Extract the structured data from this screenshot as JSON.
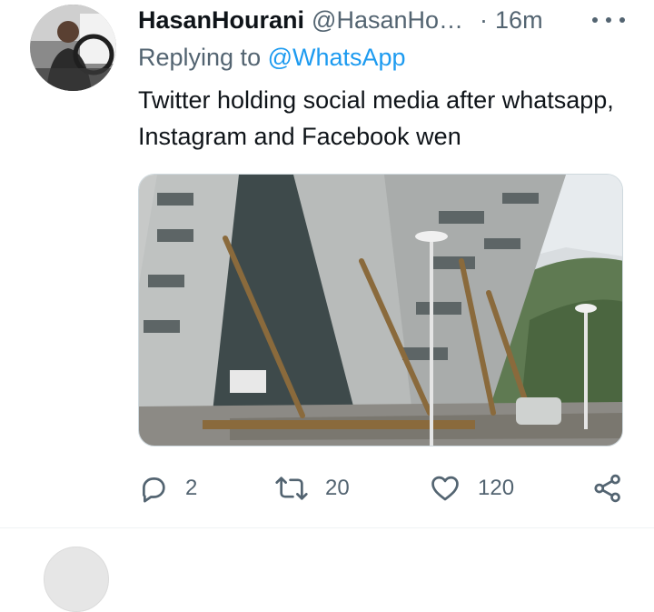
{
  "tweet": {
    "display_name": "HasanHourani",
    "handle": "@HasanHo…",
    "separator": "·",
    "time": "16m",
    "replying_prefix": "Replying to",
    "replying_to": "@WhatsApp",
    "text": "Twitter holding social media after whatsapp, Instagram and Facebook wen"
  },
  "actions": {
    "reply_count": "2",
    "retweet_count": "20",
    "like_count": "120"
  },
  "icons": [
    "more-icon",
    "reply-icon",
    "retweet-icon",
    "like-icon",
    "share-icon"
  ],
  "colors": {
    "accent": "#1d9bf0",
    "secondary_text": "#536471",
    "primary_text": "#0f1419"
  }
}
